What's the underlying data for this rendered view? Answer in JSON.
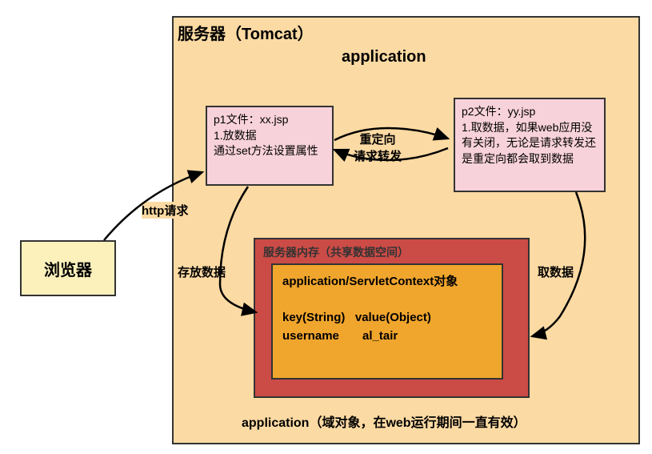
{
  "server": {
    "title": "服务器（Tomcat）",
    "app_title": "application",
    "footer": "application（域对象，在web运行期间一直有效）"
  },
  "browser": {
    "label": "浏览器"
  },
  "p1": {
    "title": "p1文件：xx.jsp",
    "line1": "1.放数据",
    "line2": "通过set方法设置属性"
  },
  "p2": {
    "title": "p2文件：yy.jsp",
    "body": "1.取数据，如果web应用没有关闭，无论是请求转发还是重定向都会取到数据"
  },
  "memory": {
    "title": "服务器内存（共享数据空间）"
  },
  "context": {
    "title": "application/ServletContext对象",
    "kv_header": "key(String)   value(Object)",
    "kv_row": "username       al_tair"
  },
  "labels": {
    "http": "http请求",
    "redirect_l1": "重定向",
    "redirect_l2": "请求转发",
    "store": "存放数据",
    "get": "取数据"
  }
}
